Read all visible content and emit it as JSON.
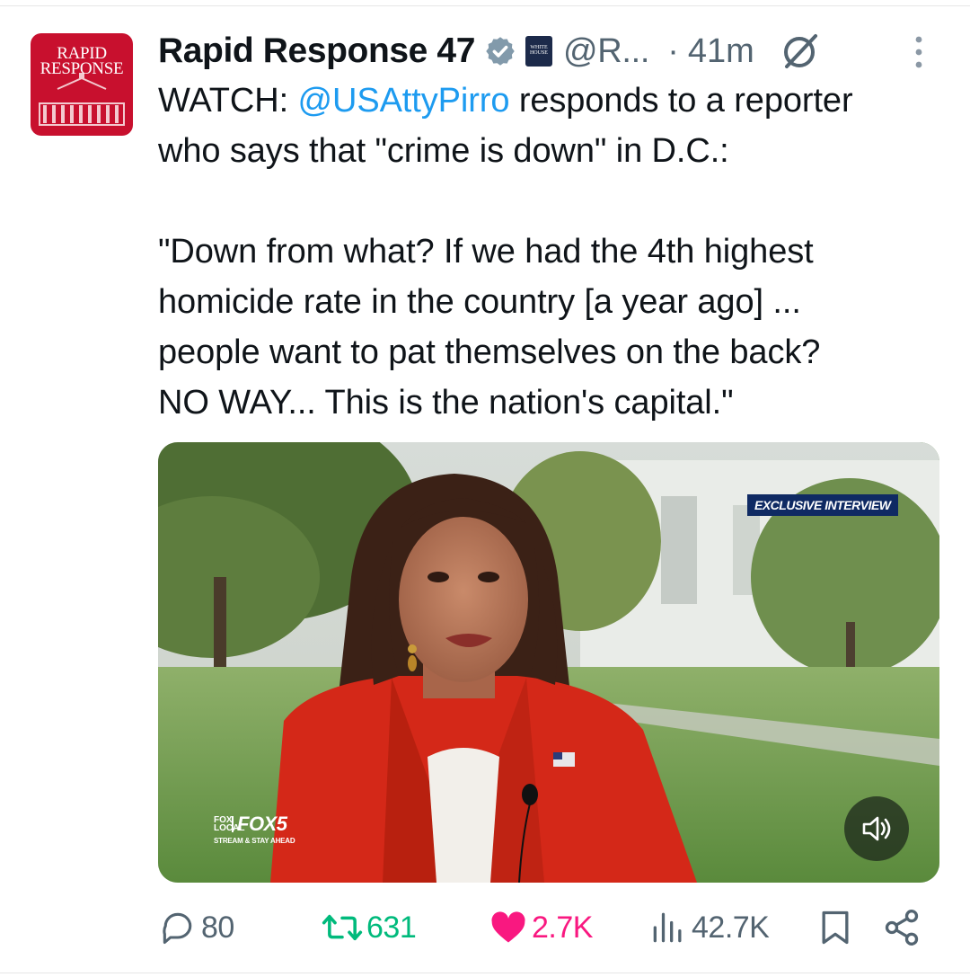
{
  "avatar": {
    "logo_text": "RAPID\nRESPONSE",
    "brand_color": "#c8102e"
  },
  "header": {
    "display_name": "Rapid Response 47",
    "verified_icon": "verified-badge-icon",
    "affiliation_icon": "white-house-affiliation-icon",
    "handle": "@R...",
    "separator": "·",
    "timestamp": "41m",
    "grok_icon": "grok-icon",
    "more_icon": "more-vertical-icon"
  },
  "tweet": {
    "prefix": "WATCH: ",
    "mention": "@USAttyPirro",
    "line1_rest": " responds to a reporter",
    "line2": "who says that \"crime is down\" in D.C.:",
    "quote": "\"Down from what? If we had the 4th highest\nhomicide rate in the country [a year ago] ...\npeople want to pat themselves on the back?\nNO WAY... This is the nation's capital.\"",
    "mention_color": "#1d9bf0"
  },
  "video": {
    "chyron": "EXCLUSIVE INTERVIEW",
    "network_small": "FOX\nLOCAL",
    "network_name": "FOX5",
    "network_tagline": "STREAM & STAY AHEAD",
    "mute_icon": "speaker-muted-icon"
  },
  "actions": {
    "reply_count": "80",
    "repost_count": "631",
    "like_count": "2.7K",
    "view_count": "42.7K",
    "repost_color": "#00ba7c",
    "like_color": "#f91880",
    "muted_color": "#536471"
  }
}
